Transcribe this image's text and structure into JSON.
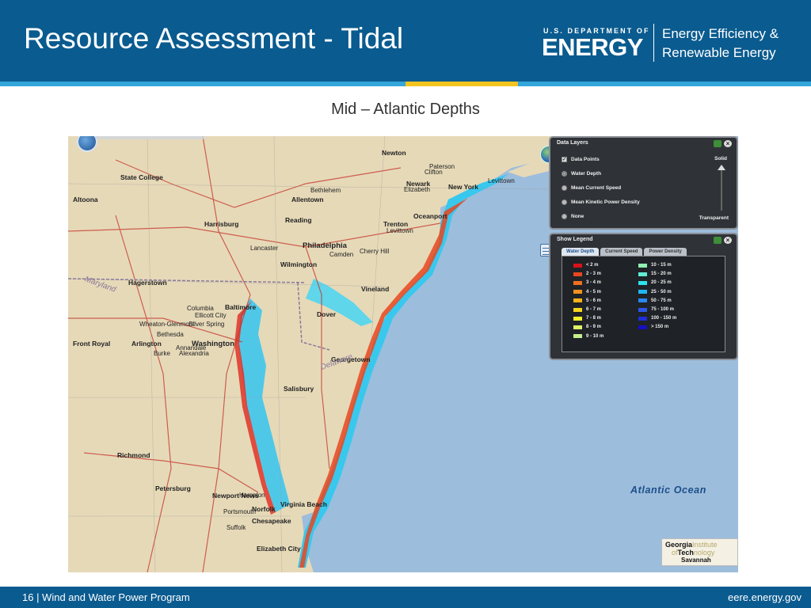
{
  "header": {
    "title": "Resource Assessment - Tidal",
    "doe_small": "U.S. DEPARTMENT OF",
    "doe_big": "ENERGY",
    "eere_line1": "Energy Efficiency &",
    "eere_line2": "Renewable Energy"
  },
  "subtitle": "Mid – Atlantic Depths",
  "map": {
    "ocean_label": "Atlantic Ocean",
    "cities": [
      {
        "name": "Newton",
        "big": true
      },
      {
        "name": "Paterson"
      },
      {
        "name": "Clifton"
      },
      {
        "name": "Newark",
        "big": true
      },
      {
        "name": "Elizabeth"
      },
      {
        "name": "New York",
        "big": true
      },
      {
        "name": "Levittown"
      },
      {
        "name": "Allentown",
        "big": true
      },
      {
        "name": "Bethlehem"
      },
      {
        "name": "Trenton",
        "big": true
      },
      {
        "name": "Levittown"
      },
      {
        "name": "Oceanport",
        "big": true
      },
      {
        "name": "State College",
        "big": true
      },
      {
        "name": "Altoona",
        "big": true
      },
      {
        "name": "Harrisburg",
        "big": true
      },
      {
        "name": "Reading",
        "big": true
      },
      {
        "name": "Lancaster"
      },
      {
        "name": "Philadelphia",
        "xl": true
      },
      {
        "name": "Camden"
      },
      {
        "name": "Cherry Hill"
      },
      {
        "name": "Wilmington",
        "big": true
      },
      {
        "name": "Vineland",
        "big": true
      },
      {
        "name": "Hagerstown",
        "big": true
      },
      {
        "name": "Columbia"
      },
      {
        "name": "Baltimore",
        "big": true
      },
      {
        "name": "Ellicott City"
      },
      {
        "name": "Wheaton-Glenmont"
      },
      {
        "name": "Silver Spring"
      },
      {
        "name": "Bethesda"
      },
      {
        "name": "Front Royal",
        "big": true
      },
      {
        "name": "Arlington",
        "big": true
      },
      {
        "name": "Washington",
        "xl": true
      },
      {
        "name": "Annandale"
      },
      {
        "name": "Alexandria"
      },
      {
        "name": "Burke"
      },
      {
        "name": "Dover",
        "big": true
      },
      {
        "name": "Georgetown",
        "big": true
      },
      {
        "name": "Salisbury",
        "big": true
      },
      {
        "name": "Richmond",
        "big": true
      },
      {
        "name": "Petersburg",
        "big": true
      },
      {
        "name": "Newport News",
        "big": true
      },
      {
        "name": "Hampton"
      },
      {
        "name": "Norfolk",
        "big": true
      },
      {
        "name": "Portsmouth"
      },
      {
        "name": "Chesapeake",
        "big": true
      },
      {
        "name": "Suffolk"
      },
      {
        "name": "Virginia Beach",
        "big": true
      },
      {
        "name": "Elizabeth City",
        "big": true
      },
      {
        "name": "Delaware"
      },
      {
        "name": "Maryland"
      }
    ],
    "logo": {
      "line1": "Georgia",
      "line1b": "Institute",
      "line2": "of",
      "line2b": "Tech",
      "line2c": "nology",
      "line3": "Savannah"
    }
  },
  "data_layers_panel": {
    "title": "Data Layers",
    "opacity_top": "Solid",
    "opacity_bottom": "Transparent",
    "items": [
      {
        "label": "Data Points",
        "control": "checkbox",
        "checked": true
      },
      {
        "label": "Water Depth",
        "control": "radio",
        "checked": true
      },
      {
        "label": "Mean Current Speed",
        "control": "radio",
        "checked": false
      },
      {
        "label": "Mean Kinetic Power Density",
        "control": "radio",
        "checked": false
      },
      {
        "label": "None",
        "control": "radio",
        "checked": false
      }
    ]
  },
  "legend_panel": {
    "title": "Show Legend",
    "tabs": [
      "Water Depth",
      "Current Speed",
      "Power Density"
    ],
    "active_tab": "Water Depth",
    "items": [
      {
        "label": "< 2 m",
        "color": "#d8121a"
      },
      {
        "label": "2 - 3 m",
        "color": "#e8461f"
      },
      {
        "label": "3 - 4 m",
        "color": "#ee7020"
      },
      {
        "label": "4 - 5 m",
        "color": "#f1921e"
      },
      {
        "label": "5 - 6 m",
        "color": "#f6b21a"
      },
      {
        "label": "6 - 7 m",
        "color": "#f8d61d"
      },
      {
        "label": "7 - 8 m",
        "color": "#f3ef2a"
      },
      {
        "label": "8 - 9 m",
        "color": "#dff26a"
      },
      {
        "label": "9 - 10 m",
        "color": "#c6f08e"
      },
      {
        "label": "10 - 15 m",
        "color": "#8ff0b2"
      },
      {
        "label": "15 - 20 m",
        "color": "#5fecd3"
      },
      {
        "label": "20 - 25 m",
        "color": "#2ee2ef"
      },
      {
        "label": "25 - 50 m",
        "color": "#1fb6f2"
      },
      {
        "label": "50 - 75 m",
        "color": "#2a86f0"
      },
      {
        "label": "75 - 100 m",
        "color": "#2b58e6"
      },
      {
        "label": "100 - 150 m",
        "color": "#1f2fd8"
      },
      {
        "label": "> 150 m",
        "color": "#1410c4"
      }
    ]
  },
  "footer": {
    "left": "16 | Wind and Water Power Program",
    "right": "eere.energy.gov"
  },
  "colors": {
    "header_bg": "#0a5b8f",
    "accent_blue": "#33a6dc",
    "accent_yellow": "#f4c41f",
    "ocean": "#9dbddc",
    "land": "#e6d9b8"
  }
}
